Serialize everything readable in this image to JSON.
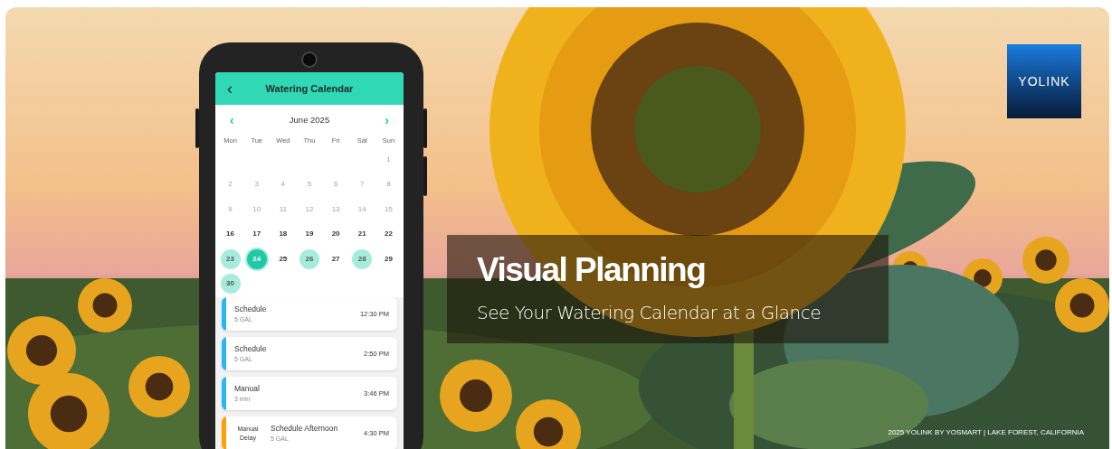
{
  "phone": {
    "header": {
      "back": "‹",
      "title": "Watering Calendar"
    },
    "calendar": {
      "prev": "‹",
      "month": "June 2025",
      "next": "›",
      "weekdays": [
        "Mon",
        "Tue",
        "Wed",
        "Thu",
        "Fri",
        "Sat",
        "Sun"
      ],
      "weeks": [
        {
          "days": [
            {
              "kind": "blank"
            },
            {
              "kind": "blank"
            },
            {
              "kind": "blank"
            },
            {
              "kind": "blank"
            },
            {
              "kind": "blank"
            },
            {
              "kind": "blank"
            },
            {
              "kind": "day",
              "label": "1",
              "past": true,
              "selected": false,
              "has_event": false
            }
          ]
        },
        {
          "days": [
            {
              "kind": "day",
              "label": "2",
              "past": true,
              "selected": false,
              "has_event": false
            },
            {
              "kind": "day",
              "label": "3",
              "past": true,
              "selected": false,
              "has_event": false
            },
            {
              "kind": "day",
              "label": "4",
              "past": true,
              "selected": false,
              "has_event": false
            },
            {
              "kind": "day",
              "label": "5",
              "past": true,
              "selected": false,
              "has_event": false
            },
            {
              "kind": "day",
              "label": "6",
              "past": true,
              "selected": false,
              "has_event": false
            },
            {
              "kind": "day",
              "label": "7",
              "past": true,
              "selected": false,
              "has_event": false
            },
            {
              "kind": "day",
              "label": "8",
              "past": true,
              "selected": false,
              "has_event": false
            }
          ]
        },
        {
          "days": [
            {
              "kind": "day",
              "label": "9",
              "past": true,
              "selected": false,
              "has_event": false
            },
            {
              "kind": "day",
              "label": "10",
              "past": true,
              "selected": false,
              "has_event": false
            },
            {
              "kind": "day",
              "label": "11",
              "past": true,
              "selected": false,
              "has_event": false
            },
            {
              "kind": "day",
              "label": "12",
              "past": true,
              "selected": false,
              "has_event": false
            },
            {
              "kind": "day",
              "label": "13",
              "past": true,
              "selected": false,
              "has_event": false
            },
            {
              "kind": "day",
              "label": "14",
              "past": true,
              "selected": false,
              "has_event": false
            },
            {
              "kind": "day",
              "label": "15",
              "past": true,
              "selected": false,
              "has_event": false
            }
          ]
        },
        {
          "days": [
            {
              "kind": "day",
              "label": "16",
              "past": false,
              "selected": false,
              "has_event": false
            },
            {
              "kind": "day",
              "label": "17",
              "past": false,
              "selected": false,
              "has_event": false
            },
            {
              "kind": "day",
              "label": "18",
              "past": false,
              "selected": false,
              "has_event": false
            },
            {
              "kind": "day",
              "label": "19",
              "past": false,
              "selected": false,
              "has_event": false
            },
            {
              "kind": "day",
              "label": "20",
              "past": false,
              "selected": false,
              "has_event": false
            },
            {
              "kind": "day",
              "label": "21",
              "past": false,
              "selected": false,
              "has_event": false
            },
            {
              "kind": "day",
              "label": "22",
              "past": false,
              "selected": false,
              "has_event": false
            }
          ]
        },
        {
          "days": [
            {
              "kind": "day",
              "label": "23",
              "past": false,
              "selected": false,
              "has_event": true
            },
            {
              "kind": "day",
              "label": "24",
              "past": false,
              "selected": true,
              "has_event": true
            },
            {
              "kind": "day",
              "label": "25",
              "past": false,
              "selected": false,
              "has_event": false
            },
            {
              "kind": "day",
              "label": "26",
              "past": false,
              "selected": false,
              "has_event": true
            },
            {
              "kind": "day",
              "label": "27",
              "past": false,
              "selected": false,
              "has_event": false
            },
            {
              "kind": "day",
              "label": "28",
              "past": false,
              "selected": false,
              "has_event": true
            },
            {
              "kind": "day",
              "label": "29",
              "past": false,
              "selected": false,
              "has_event": false
            }
          ]
        },
        {
          "days": [
            {
              "kind": "day",
              "label": "30",
              "past": false,
              "selected": false,
              "has_event": true
            }
          ]
        }
      ]
    },
    "events": [
      {
        "title": "Schedule",
        "detail": "5 GAL",
        "time": "12:30 PM",
        "color": "#29b6f6"
      },
      {
        "title": "Schedule",
        "detail": "5 GAL",
        "time": "2:50 PM",
        "color": "#29b6f6"
      },
      {
        "title": "Manual",
        "detail": "3 min",
        "time": "3:46 PM",
        "color": "#29b6f6"
      },
      {
        "tag": "Manual Delay",
        "title": "Schedule Afternoon",
        "detail": "5 GAL",
        "time": "4:30 PM",
        "color": "#ffa000"
      }
    ]
  },
  "headline": {
    "title": "Visual Planning",
    "subtitle": "See Your Watering Calendar at a Glance"
  },
  "logo": {
    "text": "YOLINK"
  },
  "footer": "2025 YOLINK BY YOSMART | LAKE FOREST, CALIFORNIA"
}
